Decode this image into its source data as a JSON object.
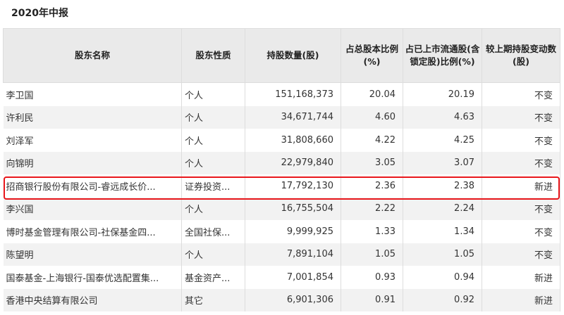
{
  "title": "2020年中报",
  "headers": [
    "股东名称",
    "股东性质",
    "持股数量(股)",
    "占总股本比例(%)",
    "占已上市流通股(含锁定股)比例(%)",
    "较上期持股变动数(股)"
  ],
  "rows": [
    [
      "李卫国",
      "个人",
      "151,168,373",
      "20.04",
      "20.19",
      "不变"
    ],
    [
      "许利民",
      "个人",
      "34,671,744",
      "4.60",
      "4.63",
      "不变"
    ],
    [
      "刘泽军",
      "个人",
      "31,808,660",
      "4.22",
      "4.25",
      "不变"
    ],
    [
      "向锦明",
      "个人",
      "22,979,840",
      "3.05",
      "3.07",
      "不变"
    ],
    [
      "招商银行股份有限公司-睿远成长价...",
      "证券投资...",
      "17,792,130",
      "2.36",
      "2.38",
      "新进"
    ],
    [
      "李兴国",
      "个人",
      "16,755,504",
      "2.22",
      "2.24",
      "不变"
    ],
    [
      "博时基金管理有限公司-社保基金四...",
      "全国社保...",
      "9,999,925",
      "1.33",
      "1.34",
      "不变"
    ],
    [
      "陈望明",
      "个人",
      "7,891,104",
      "1.05",
      "1.05",
      "不变"
    ],
    [
      "国泰基金-上海银行-国泰优选配置集...",
      "基金资产...",
      "7,001,854",
      "0.93",
      "0.94",
      "新进"
    ],
    [
      "香港中央结算有限公司",
      "其它",
      "6,901,306",
      "0.91",
      "0.92",
      "新进"
    ]
  ],
  "highlight_color": "#e8161b"
}
